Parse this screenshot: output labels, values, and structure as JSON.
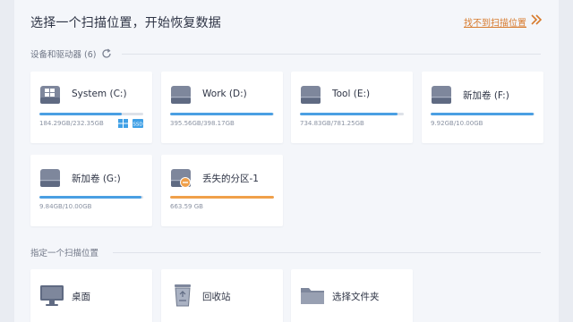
{
  "header": {
    "title": "选择一个扫描位置，开始恢复数据",
    "help_link": "找不到扫描位置",
    "help_icon": "double-chevron-right-icon"
  },
  "devices": {
    "section_label": "设备和驱动器 (6)",
    "refresh_icon": "refresh-icon",
    "accent_color": "#4a9fe3",
    "items": [
      {
        "name": "System (C:)",
        "size": "184.29GB/232.35GB",
        "used_fraction": 0.79,
        "icon": "windows-system-drive-icon",
        "badges": [
          "windows-icon",
          "ssd-icon"
        ],
        "ssd_label": "SSD"
      },
      {
        "name": "Work (D:)",
        "size": "395.56GB/398.17GB",
        "used_fraction": 0.99,
        "icon": "hard-drive-icon"
      },
      {
        "name": "Tool (E:)",
        "size": "734.83GB/781.25GB",
        "used_fraction": 0.94,
        "icon": "hard-drive-icon"
      },
      {
        "name": "新加卷 (F:)",
        "size": "9.92GB/10.00GB",
        "used_fraction": 0.99,
        "icon": "hard-drive-icon"
      },
      {
        "name": "新加卷 (G:)",
        "size": "9.84GB/10.00GB",
        "used_fraction": 0.98,
        "icon": "hard-drive-icon"
      },
      {
        "name": "丢失的分区-1",
        "size": "663.59 GB",
        "used_fraction": 1.0,
        "icon": "lost-partition-icon",
        "bar_color": "#f0a04a"
      }
    ]
  },
  "locations": {
    "section_label": "指定一个扫描位置",
    "items": [
      {
        "name": "桌面",
        "icon": "desktop-monitor-icon"
      },
      {
        "name": "回收站",
        "icon": "recycle-bin-icon"
      },
      {
        "name": "选择文件夹",
        "icon": "folder-icon"
      }
    ]
  }
}
